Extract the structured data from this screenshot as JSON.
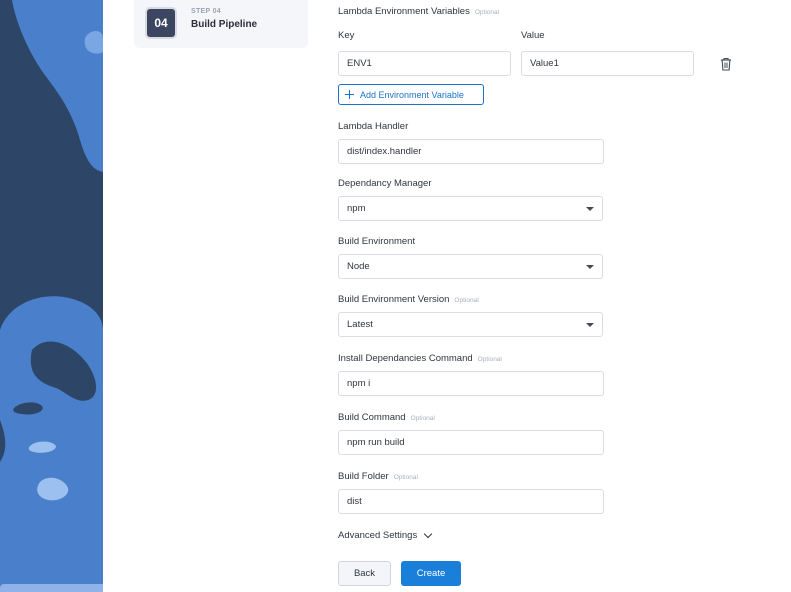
{
  "stepper": {
    "step_number": "04",
    "step_kicker": "STEP 04",
    "step_title": "Build Pipeline"
  },
  "form": {
    "optional_tag": "Optional",
    "env_vars": {
      "label": "Lambda Environment Variables",
      "key_header": "Key",
      "value_header": "Value",
      "rows": [
        {
          "key": "ENV1",
          "value": "Value1"
        }
      ],
      "add_button": "Add Environment Variable"
    },
    "lambda_handler": {
      "label": "Lambda Handler",
      "value": "dist/index.handler"
    },
    "dependency_manager": {
      "label": "Dependancy Manager",
      "value": "npm"
    },
    "build_environment": {
      "label": "Build Environment",
      "value": "Node"
    },
    "build_environment_version": {
      "label": "Build Environment Version",
      "value": "Latest"
    },
    "install_command": {
      "label": "Install Dependancies Command",
      "value": "npm i"
    },
    "build_command": {
      "label": "Build Command",
      "value": "npm run build"
    },
    "build_folder": {
      "label": "Build Folder",
      "value": "dist"
    },
    "advanced_settings": "Advanced Settings",
    "back_button": "Back",
    "create_button": "Create"
  },
  "icons": {
    "trash": "trash-icon",
    "plus": "plus-icon",
    "chevron": "chevron-down-icon",
    "caret": "caret-down-icon"
  },
  "colors": {
    "primary": "#1a7fd9",
    "art_dark": "#2d4668",
    "art_light": "#4a7fcb"
  }
}
